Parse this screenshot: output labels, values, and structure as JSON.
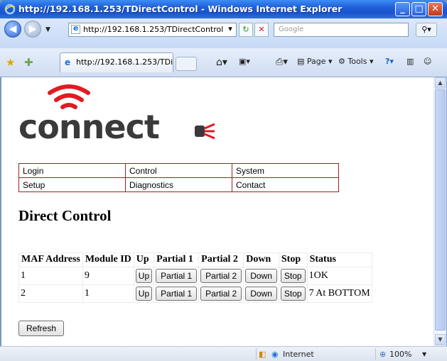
{
  "window": {
    "title": "http://192.168.1.253/TDirectControl - Windows Internet Explorer"
  },
  "address_bar": {
    "url": "http://192.168.1.253/TDirectControl",
    "search_placeholder": "Google"
  },
  "tab": {
    "label": "http://192.168.1.253/TDir..."
  },
  "toolbar": {
    "page_label": "Page",
    "tools_label": "Tools"
  },
  "logo": {
    "text": "connect"
  },
  "nav_menu": {
    "rows": [
      [
        "Login",
        "Control",
        "System"
      ],
      [
        "Setup",
        "Diagnostics",
        "Contact"
      ]
    ]
  },
  "page_heading": "Direct Control",
  "control_table": {
    "headers": [
      "MAF Address",
      "Module ID",
      "Up",
      "Partial 1",
      "Partial 2",
      "Down",
      "Stop",
      "Status"
    ],
    "button_labels": {
      "up": "Up",
      "partial1": "Partial 1",
      "partial2": "Partial 2",
      "down": "Down",
      "stop": "Stop"
    },
    "rows": [
      {
        "maf_address": "1",
        "module_id": "9",
        "status": "1OK"
      },
      {
        "maf_address": "2",
        "module_id": "1",
        "status": "7 At BOTTOM"
      }
    ]
  },
  "refresh_button": "Refresh",
  "status_bar": {
    "zone": "Internet",
    "zoom": "100%"
  },
  "colors": {
    "menu_border": "#9b2222",
    "logo_red": "#e11b22",
    "titlebar_blue": "#1f5fd8"
  }
}
